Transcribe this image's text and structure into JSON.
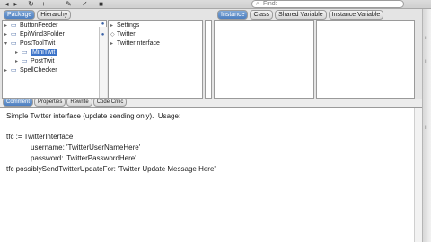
{
  "toolbar": {
    "find_placeholder": "Find:"
  },
  "left_panel": {
    "tabs": [
      {
        "label": "Package",
        "active": true
      },
      {
        "label": "Hierarchy",
        "active": false
      }
    ],
    "items": [
      {
        "label": "ButtonFeeder",
        "indent": 0,
        "expanded": false,
        "selected": false
      },
      {
        "label": "EpiWind3Folder",
        "indent": 0,
        "expanded": false,
        "selected": false
      },
      {
        "label": "PostToolTwit",
        "indent": 0,
        "expanded": true,
        "selected": false
      },
      {
        "label": "MiniTwit",
        "indent": 1,
        "expanded": false,
        "selected": true
      },
      {
        "label": "PostTwit",
        "indent": 1,
        "expanded": false,
        "selected": false
      },
      {
        "label": "SpellChecker",
        "indent": 0,
        "expanded": false,
        "selected": false
      }
    ]
  },
  "class_panel": {
    "items": [
      {
        "label": "Settings",
        "marker": "▸"
      },
      {
        "label": "Twitter",
        "marker": "◇"
      },
      {
        "label": "TwitterInterface",
        "marker": "▸"
      }
    ]
  },
  "right_panel": {
    "tabs": [
      {
        "label": "Instance",
        "active": true
      },
      {
        "label": "Class",
        "active": false
      },
      {
        "label": "Shared Variable",
        "active": false
      },
      {
        "label": "Instance Variable",
        "active": false
      }
    ]
  },
  "editor_tabs": [
    {
      "label": "Comment",
      "active": true
    },
    {
      "label": "Properties",
      "active": false
    },
    {
      "label": "Rewrite",
      "active": false
    },
    {
      "label": "Code Critic",
      "active": false
    }
  ],
  "editor": {
    "lines": [
      "Simple Twitter interface (update sending only).  Usage:",
      "tfc := TwitterInterface",
      "username: 'TwitterUserNameHere'",
      "password: 'TwitterPasswordHere'.",
      "tfc possiblySendTwitterUpdateFor: 'Twitter Update Message Here'"
    ]
  }
}
